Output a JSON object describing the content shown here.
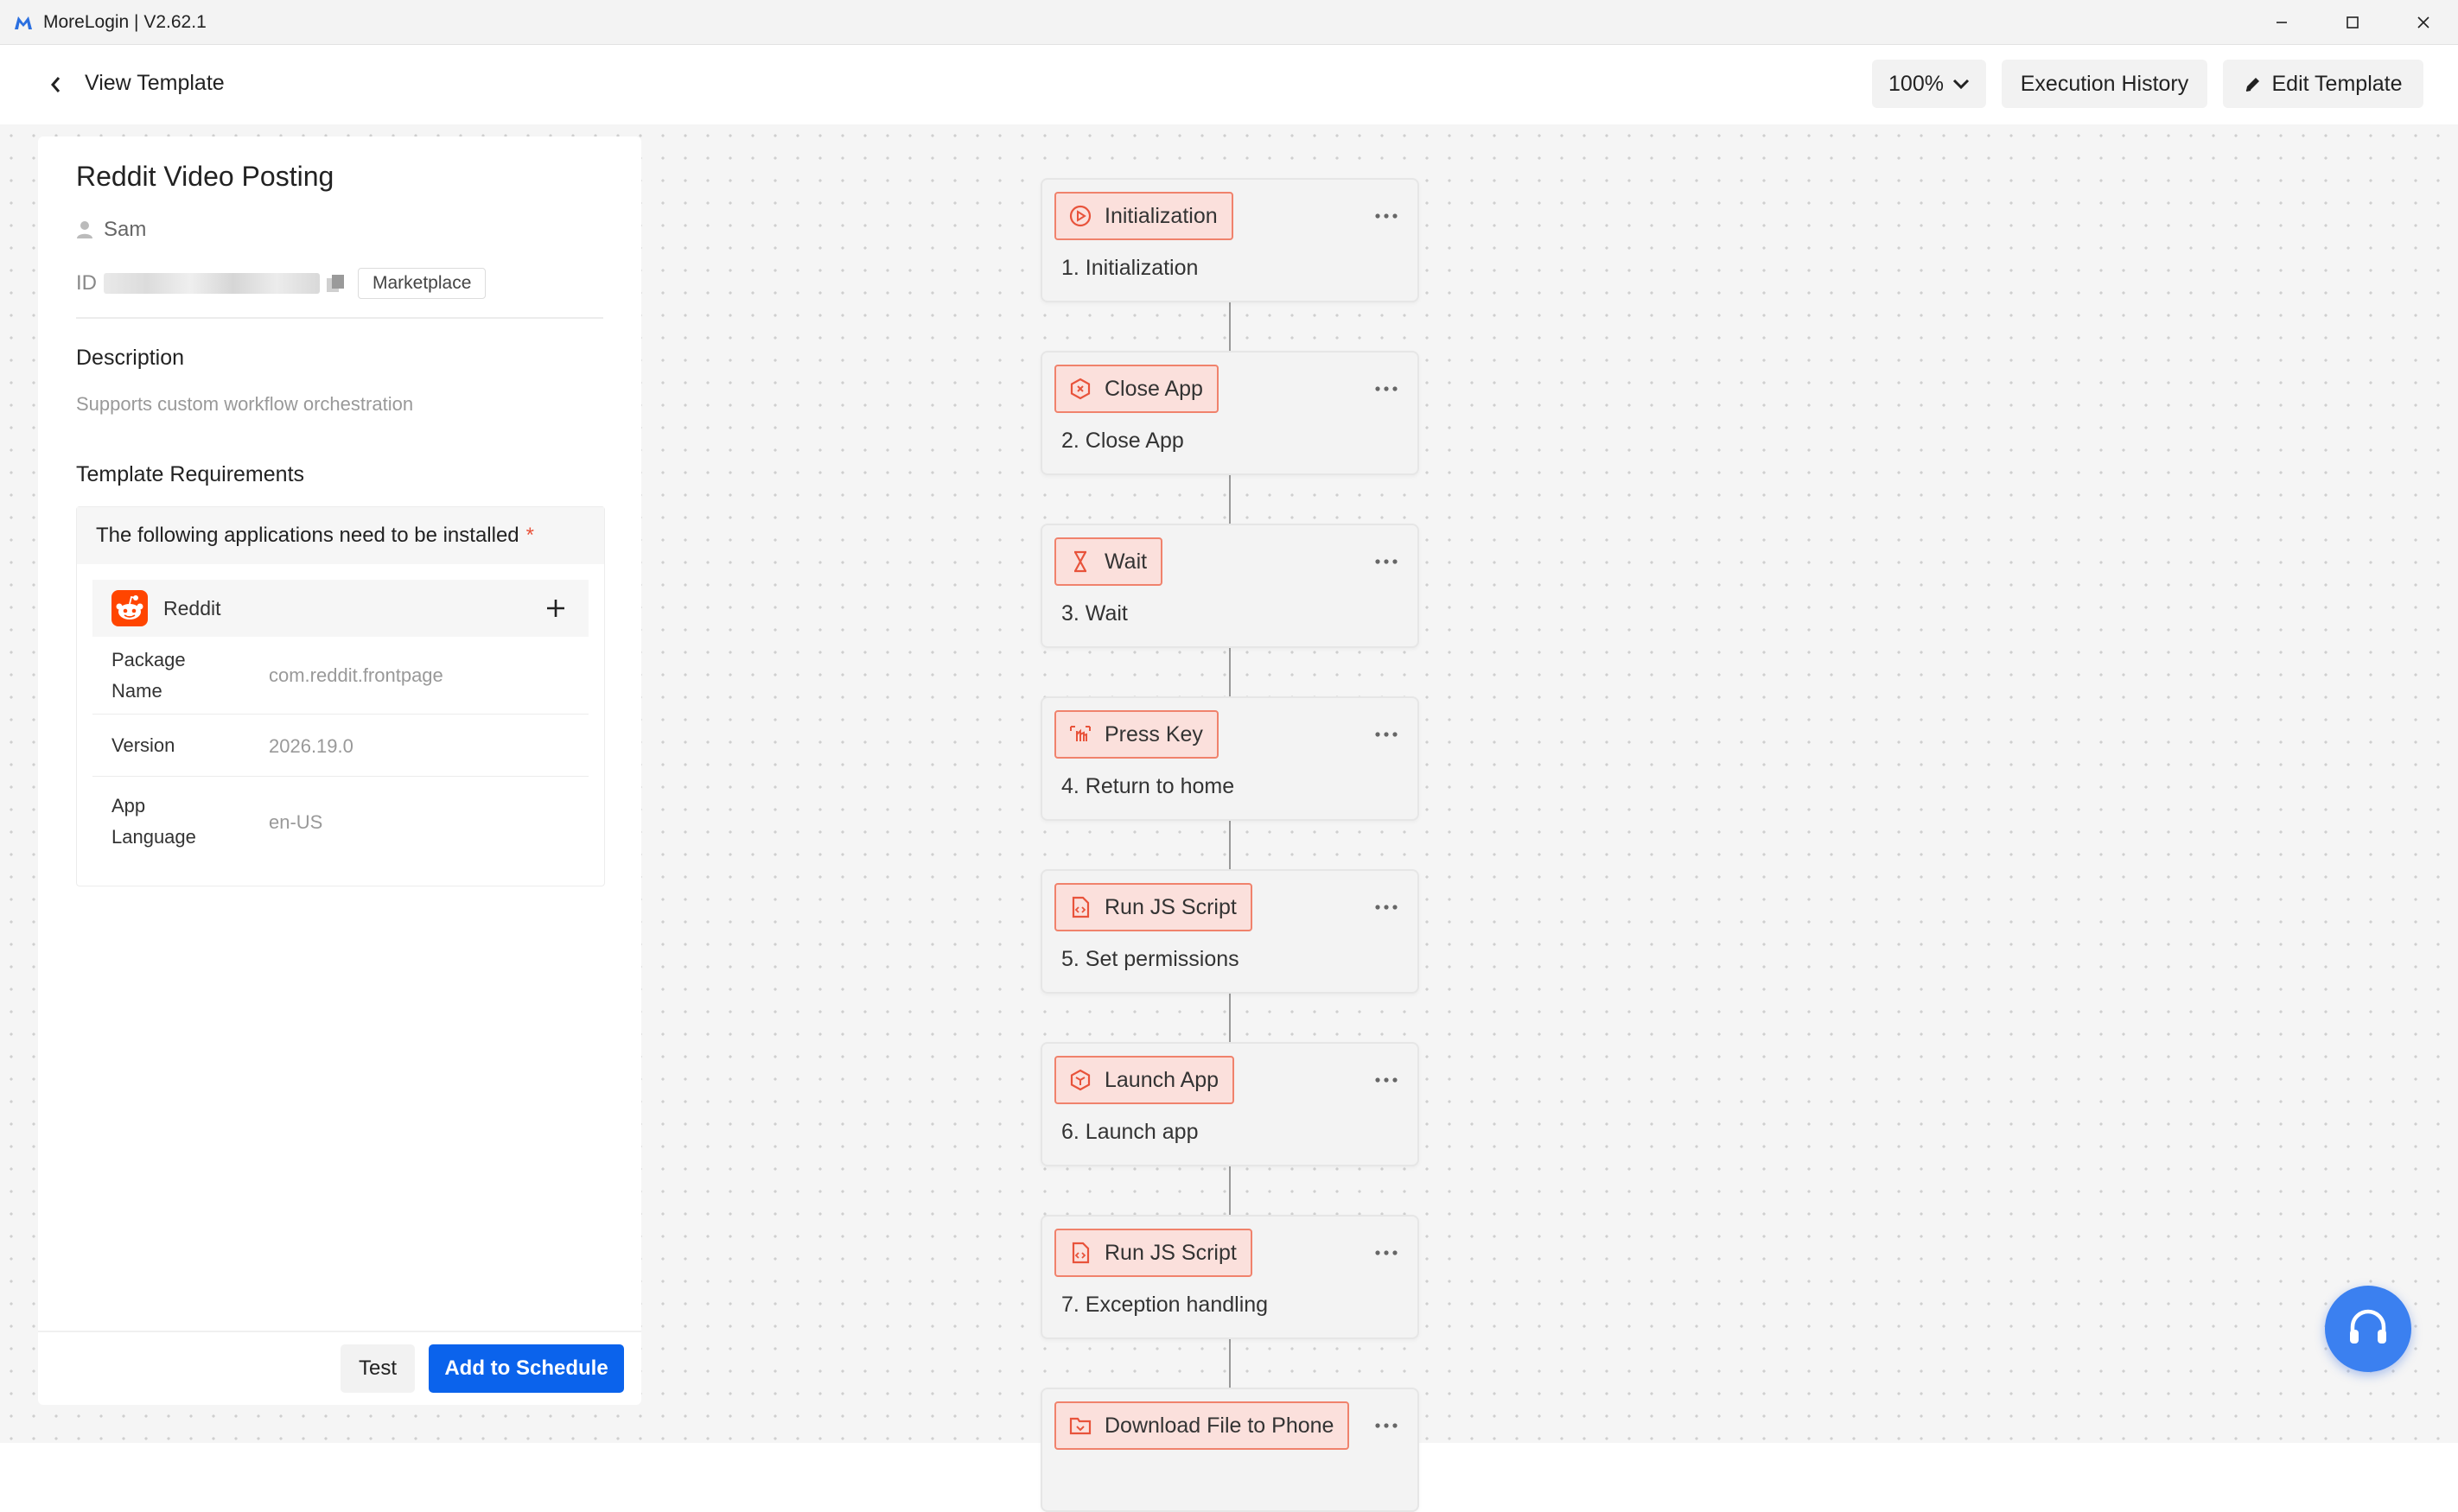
{
  "window": {
    "title": "MoreLogin | V2.62.1"
  },
  "header": {
    "back_label": "View Template",
    "zoom": "100%",
    "execution_history": "Execution History",
    "edit_template": "Edit Template"
  },
  "template": {
    "title": "Reddit Video Posting",
    "author": "Sam",
    "id_label": "ID",
    "source_tag": "Marketplace",
    "description_heading": "Description",
    "description": "Supports custom workflow orchestration",
    "requirements_heading": "Template Requirements",
    "requirements_note": "The following applications need to be installed",
    "required_mark": "*",
    "app": {
      "name": "Reddit",
      "package_name_label": [
        "Package",
        "Name"
      ],
      "package_name": "com.reddit.frontpage",
      "version_label": "Version",
      "version": "2026.19.0",
      "language_label": [
        "App",
        "Language"
      ],
      "language": "en-US"
    }
  },
  "footer": {
    "test": "Test",
    "add_to_schedule": "Add to Schedule"
  },
  "steps": [
    {
      "type": "Initialization",
      "icon": "play-circle-icon",
      "label": "1. Initialization"
    },
    {
      "type": "Close App",
      "icon": "close-app-icon",
      "label": "2. Close App"
    },
    {
      "type": "Wait",
      "icon": "hourglass-icon",
      "label": "3. Wait"
    },
    {
      "type": "Press Key",
      "icon": "press-key-icon",
      "label": "4. Return to home"
    },
    {
      "type": "Run JS Script",
      "icon": "script-file-icon",
      "label": "5. Set permissions"
    },
    {
      "type": "Launch App",
      "icon": "launch-app-icon",
      "label": "6. Launch app"
    },
    {
      "type": "Run JS Script",
      "icon": "script-file-icon",
      "label": "7. Exception handling"
    },
    {
      "type": "Download File to Phone",
      "icon": "download-folder-icon",
      "label": ""
    }
  ],
  "colors": {
    "accent": "#0b63ec",
    "step_chip_bg": "#fbe0dc",
    "step_chip_border": "#f0826c",
    "step_icon": "#e8533b",
    "reddit": "#ff4500",
    "help_fab": "#3b80f0"
  }
}
